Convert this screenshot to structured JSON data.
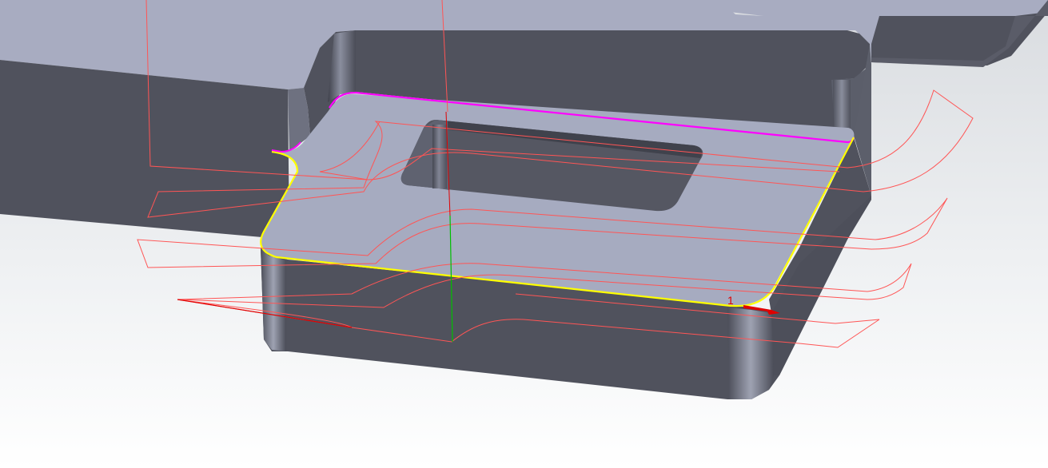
{
  "viewport": {
    "marker": {
      "label": "1",
      "color": "#e00000"
    }
  },
  "colors": {
    "background_top": "#d9dce0",
    "background_bottom": "#ffffff",
    "face_top": "#a7acc1",
    "face_side_dark": "#50525e",
    "toolpath": "#ff5555",
    "contour_selection": "#ffff00",
    "wall_selection": "#ff00ff",
    "axis_x": "#e00000",
    "axis_y": "#00c000"
  }
}
